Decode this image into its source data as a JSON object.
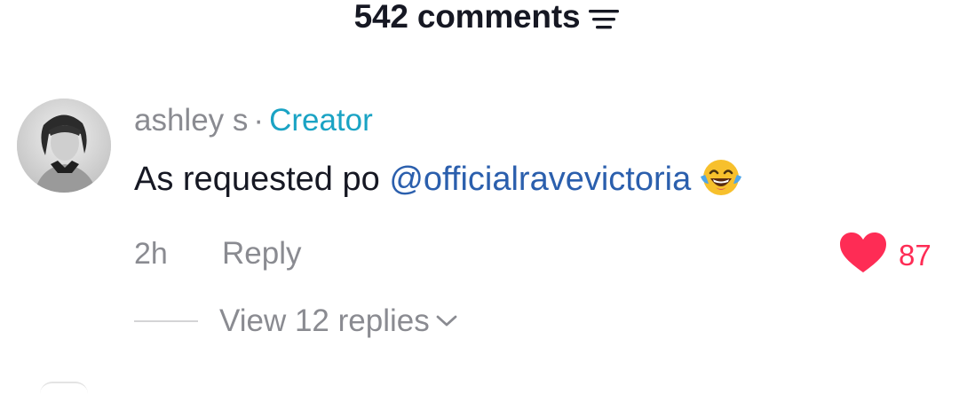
{
  "header": {
    "comments_count_label": "542 comments",
    "sort_icon": "sort-lines-icon"
  },
  "comment": {
    "avatar_icon": "user-avatar",
    "username": "ashley s",
    "separator": "·",
    "badge": "Creator",
    "text_prefix": "As requested po",
    "mention": "@officialravevictoria",
    "emoji_icon": "tears-of-joy-emoji",
    "time": "2h",
    "reply_label": "Reply",
    "like_icon": "heart-icon",
    "like_count": "87",
    "view_replies_label": "View 12 replies",
    "expand_icon": "chevron-down-icon"
  },
  "colors": {
    "creator": "#1aa3c4",
    "mention": "#2b5fad",
    "like": "#fe2c55",
    "muted": "#8a8b91",
    "text": "#161823"
  }
}
